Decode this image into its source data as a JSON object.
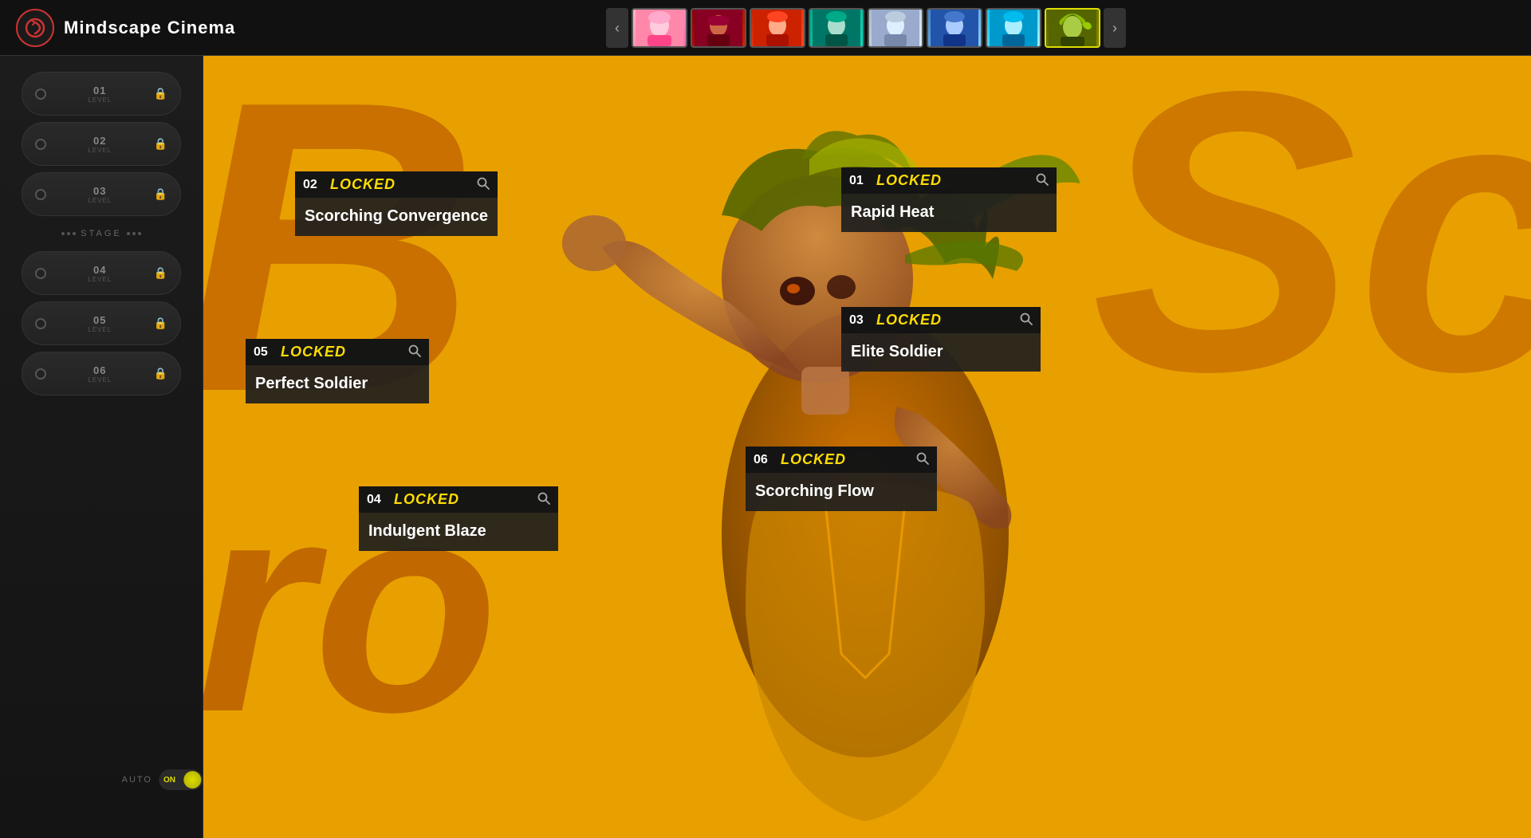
{
  "header": {
    "logo_symbol": "↺",
    "title": "Mindscape Cinema"
  },
  "char_nav": {
    "prev_label": "‹",
    "next_label": "›",
    "characters": [
      {
        "id": 1,
        "name": "char-1",
        "active": false
      },
      {
        "id": 2,
        "name": "char-2",
        "active": false
      },
      {
        "id": 3,
        "name": "char-3",
        "active": false
      },
      {
        "id": 4,
        "name": "char-4",
        "active": false
      },
      {
        "id": 5,
        "name": "char-5",
        "active": false
      },
      {
        "id": 6,
        "name": "char-6",
        "active": false
      },
      {
        "id": 7,
        "name": "char-7",
        "active": false
      },
      {
        "id": 8,
        "name": "char-8",
        "active": true
      }
    ]
  },
  "sidebar": {
    "items": [
      {
        "num": "01",
        "label": "LEVEL",
        "locked": true
      },
      {
        "num": "02",
        "label": "LEVEL",
        "locked": true
      },
      {
        "num": "03",
        "label": "LEVEL",
        "locked": true
      },
      {
        "num": "04",
        "label": "LEVEL",
        "locked": true
      },
      {
        "num": "05",
        "label": "LEVEL",
        "locked": true
      },
      {
        "num": "06",
        "label": "LEVEL",
        "locked": true
      }
    ],
    "stage_label": "STAGE",
    "auto_label": "AUTO",
    "toggle_state": "ON"
  },
  "episodes": [
    {
      "id": "01",
      "status": "LOCKED",
      "title": "Rapid Heat",
      "search_icon": "🔍"
    },
    {
      "id": "02",
      "status": "LOCKED",
      "title": "Scorching Convergence",
      "search_icon": "🔍"
    },
    {
      "id": "03",
      "status": "LOCKED",
      "title": "Elite Soldier",
      "search_icon": "🔍"
    },
    {
      "id": "04",
      "status": "LOCKED",
      "title": "Indulgent Blaze",
      "search_icon": "🔍"
    },
    {
      "id": "05",
      "status": "LOCKED",
      "title": "Perfect Soldier",
      "search_icon": "🔍"
    },
    {
      "id": "06",
      "status": "LOCKED",
      "title": "Scorching Flow",
      "search_icon": "🔍"
    }
  ],
  "bg": {
    "letter1": "B",
    "letter2": "ro",
    "letter3": "Sc"
  }
}
